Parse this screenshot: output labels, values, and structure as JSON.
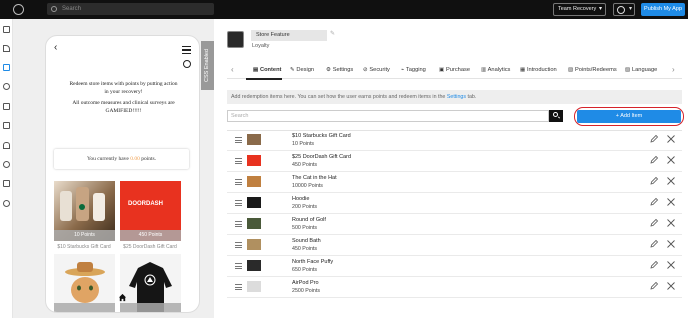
{
  "topbar": {
    "search_placeholder": "Search",
    "team_label": "Team Recovery",
    "publish_label": "Publish My App",
    "accent": "#1f8be6"
  },
  "sidebar": {
    "icons": [
      "grid-icon",
      "pen-icon",
      "pages-icon",
      "palette-icon",
      "lock-icon",
      "cart-icon",
      "bell-icon",
      "users-icon",
      "chart-icon",
      "gear-icon"
    ]
  },
  "preview": {
    "css_tab_label": "CSS Enabled",
    "intro_line1": "Redeem store items with points by putting action",
    "intro_line2": "in your recovery!",
    "intro_line3": "All outcome measures and clinical surveys are",
    "intro_line4": "GAMIFIED!!!!!",
    "points_prefix": "You currently have",
    "points_value": "0.00",
    "points_suffix": "points.",
    "tiles": [
      {
        "points": "10 Points",
        "label": "$10 Starbucks Gift Card"
      },
      {
        "points": "450 Points",
        "label": "$25 DoorDash Gift Card"
      },
      {
        "points": "",
        "label": ""
      },
      {
        "points": "",
        "label": ""
      }
    ],
    "doordash_text": "DOORDASH"
  },
  "editor": {
    "feature_name": "Store Feature",
    "feature_sub": "Loyalty",
    "tabs": [
      "Content",
      "Design",
      "Settings",
      "Security",
      "Tagging",
      "Purchase",
      "Analytics",
      "Introduction",
      "Points/Redeems",
      "Language"
    ],
    "active_tab": "Content",
    "info_text": "Add redemption items here. You can set how the user earns points and redeem items in the",
    "info_link": "Settings",
    "info_suffix": "tab.",
    "search_placeholder": "Search",
    "add_label": "+ Add Item",
    "highlight_color": "#d6232a"
  },
  "items": [
    {
      "name": "$10 Starbucks Gift Card",
      "points": "10 Points",
      "thumb": "#8a6a4a"
    },
    {
      "name": "$25 DoorDash Gift Card",
      "points": "450 Points",
      "thumb": "#e8321f"
    },
    {
      "name": "The Cat in the Hat",
      "points": "10000 Points",
      "thumb": "#c08040"
    },
    {
      "name": "Hoodie",
      "points": "200 Points",
      "thumb": "#1a1a1a"
    },
    {
      "name": "Round of Golf",
      "points": "500 Points",
      "thumb": "#4a5a3a"
    },
    {
      "name": "Sound Bath",
      "points": "450 Points",
      "thumb": "#b09060"
    },
    {
      "name": "North Face Puffy",
      "points": "650 Points",
      "thumb": "#2a2a2a"
    },
    {
      "name": "AirPod Pro",
      "points": "2500 Points",
      "thumb": "#dcdcdc"
    }
  ]
}
